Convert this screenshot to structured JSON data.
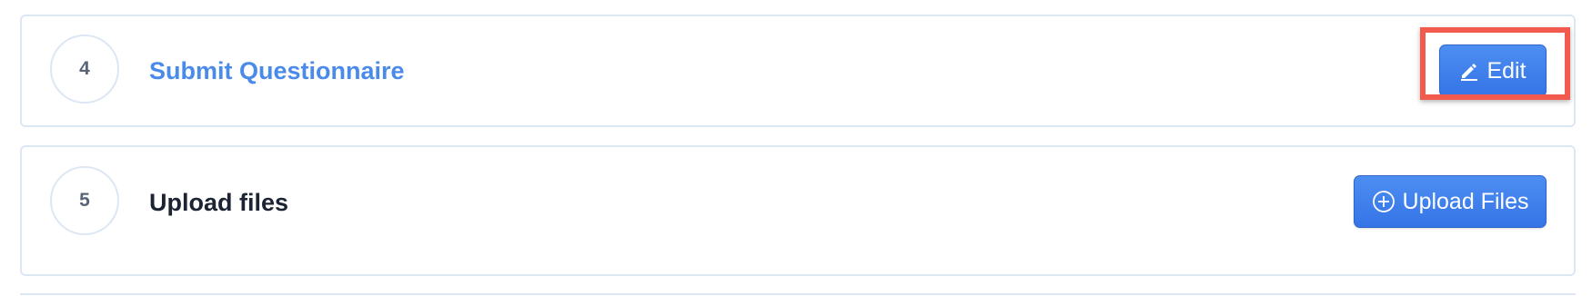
{
  "steps": [
    {
      "number": "4",
      "title": "Submit Questionnaire",
      "button": {
        "label": "Edit",
        "icon": "pencil-icon"
      }
    },
    {
      "number": "5",
      "title": "Upload files",
      "button": {
        "label": "Upload Files",
        "icon": "plus-circle-icon"
      }
    }
  ],
  "colors": {
    "link_title": "#4a8bea",
    "primary_button": "#3b7ce9",
    "highlight": "#f15a4c",
    "border": "#dde7f3"
  }
}
